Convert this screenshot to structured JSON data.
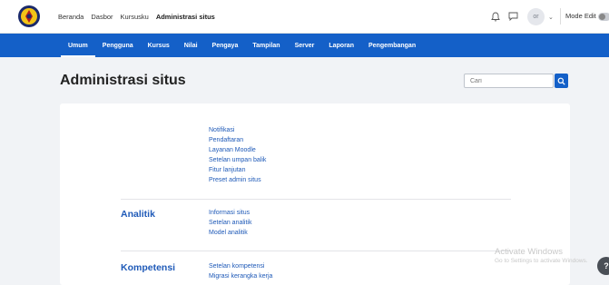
{
  "top_nav": {
    "items": [
      "Beranda",
      "Dasbor",
      "Kursusku",
      "Administrasi situs"
    ],
    "active_index": 3
  },
  "user": {
    "initials": "or",
    "mode_edit_label": "Mode Edit"
  },
  "admin_tabs": [
    "Umum",
    "Pengguna",
    "Kursus",
    "Nilai",
    "Pengaya",
    "Tampilan",
    "Server",
    "Laporan",
    "Pengembangan"
  ],
  "page": {
    "title": "Administrasi situs",
    "search_placeholder": "Cari"
  },
  "general_links": [
    "Notifikasi",
    "Pendaftaran",
    "Layanan Moodle",
    "Setelan umpan balik",
    "Fitur lanjutan",
    "Preset admin situs"
  ],
  "sections": [
    {
      "title": "Analitik",
      "links": [
        "Informasi situs",
        "Setelan analitik",
        "Model analitik"
      ]
    },
    {
      "title": "Kompetensi",
      "links": [
        "Setelan kompetensi",
        "Migrasi kerangka kerja"
      ]
    }
  ],
  "watermark": {
    "line1": "Activate Windows",
    "line2": "Go to Settings to activate Windows."
  },
  "help_label": "?",
  "colors": {
    "primary": "#1460c8",
    "link": "#1f5ab8"
  }
}
